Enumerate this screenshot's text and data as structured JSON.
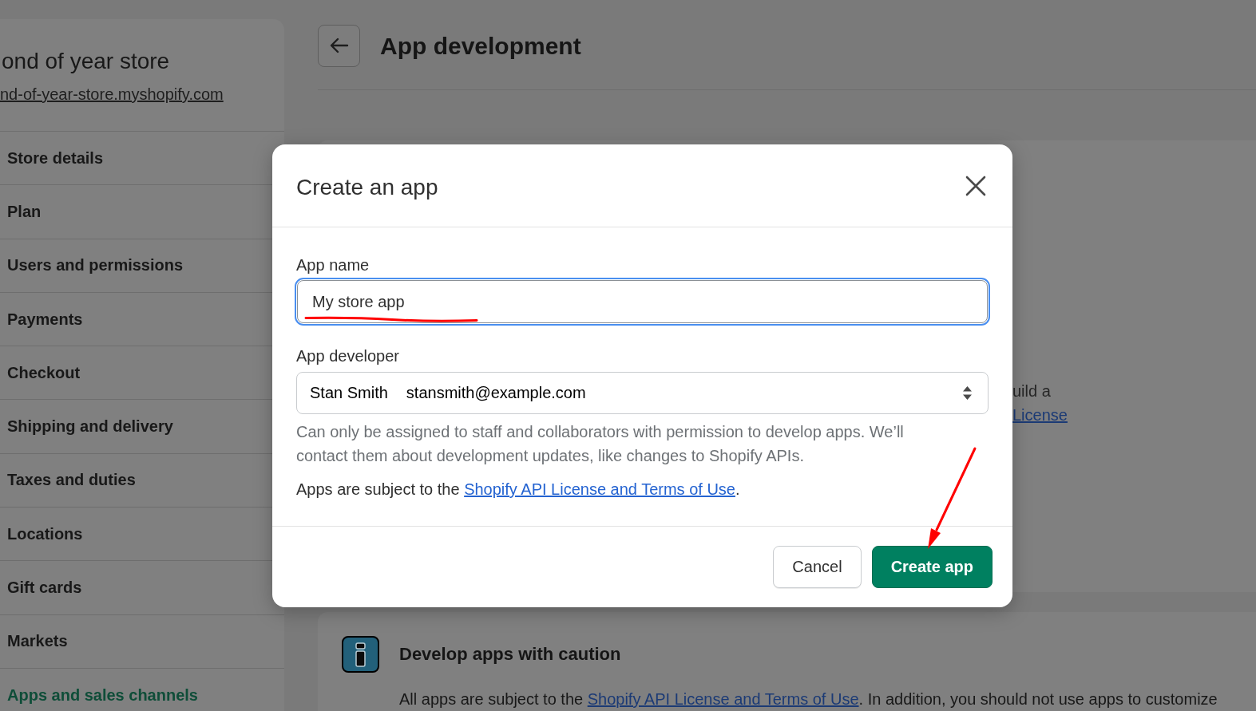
{
  "sidebar": {
    "store_name": "ond of year store",
    "store_url": "nd-of-year-store.myshopify.com",
    "items": [
      {
        "label": "Store details",
        "selected": false
      },
      {
        "label": "Plan",
        "selected": false
      },
      {
        "label": "Users and permissions",
        "selected": false
      },
      {
        "label": "Payments",
        "selected": false
      },
      {
        "label": "Checkout",
        "selected": false
      },
      {
        "label": "Shipping and delivery",
        "selected": false
      },
      {
        "label": "Taxes and duties",
        "selected": false
      },
      {
        "label": "Locations",
        "selected": false
      },
      {
        "label": "Gift cards",
        "selected": false
      },
      {
        "label": "Markets",
        "selected": false
      },
      {
        "label": "Apps and sales channels",
        "selected": true
      }
    ]
  },
  "page": {
    "title": "App development",
    "partial_card": {
      "text": "uild a",
      "link": "License"
    },
    "caution_card": {
      "title": "Develop apps with caution",
      "text_before": "All apps are subject to the ",
      "link": "Shopify API License and Terms of Use",
      "text_after": ". In addition, you should not use apps to customize"
    }
  },
  "modal": {
    "title": "Create an app",
    "app_name": {
      "label": "App name",
      "value": "My store app",
      "focused": true
    },
    "app_developer": {
      "label": "App developer",
      "name": "Stan Smith",
      "email": "stansmith@example.com",
      "help": "Can only be assigned to staff and collaborators with permission to develop apps. We’ll contact them about development updates, like changes to Shopify APIs."
    },
    "terms": {
      "text_before": "Apps are subject to the ",
      "link": "Shopify API License and Terms of Use",
      "text_after": "."
    },
    "buttons": [
      {
        "label": "Cancel",
        "kind": "secondary"
      },
      {
        "label": "Create app",
        "kind": "primary"
      }
    ]
  },
  "annotations": {
    "app_name_underlined": true,
    "create_button_arrow": true
  }
}
